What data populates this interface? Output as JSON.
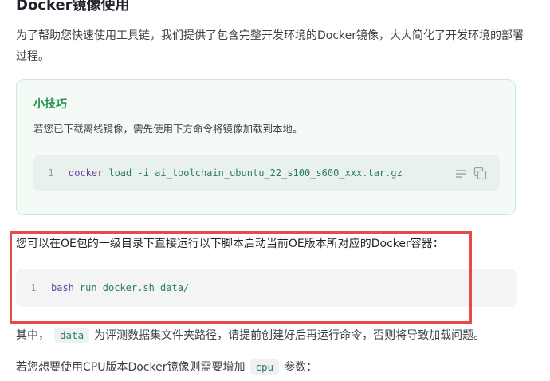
{
  "heading": "Docker镜像使用",
  "intro": "为了帮助您快速使用工具链，我们提供了包含完整开发环境的Docker镜像，大大简化了开发环境的部署过程。",
  "tip": {
    "title": "小技巧",
    "text": "若您已下载离线镜像，需先使用下方命令将镜像加载到本地。",
    "code": {
      "line_no": "1",
      "command": "docker",
      "args": "load -i ai_toolchain_ubuntu_22_s100_s600_xxx.tar.gz"
    },
    "icons": [
      "wrap-icon",
      "copy-icon"
    ]
  },
  "run_paragraph": "您可以在OE包的一级目录下直接运行以下脚本启动当前OE版本所对应的Docker容器：",
  "run_code": {
    "line_no": "1",
    "command": "bash",
    "args": "run_docker.sh data/"
  },
  "data_paragraph": {
    "before": "其中，",
    "code": "data",
    "after": "为评测数据集文件夹路径，请提前创建好后再运行命令，否则将导致加载问题。"
  },
  "cpu_paragraph": {
    "before": "若您想要使用CPU版本Docker镜像则需要增加",
    "code": "cpu",
    "after": "参数："
  },
  "colors": {
    "highlight_border": "#e84a4a",
    "tip_title": "#1f8f4e",
    "tip_background": "#f4fbf7"
  }
}
